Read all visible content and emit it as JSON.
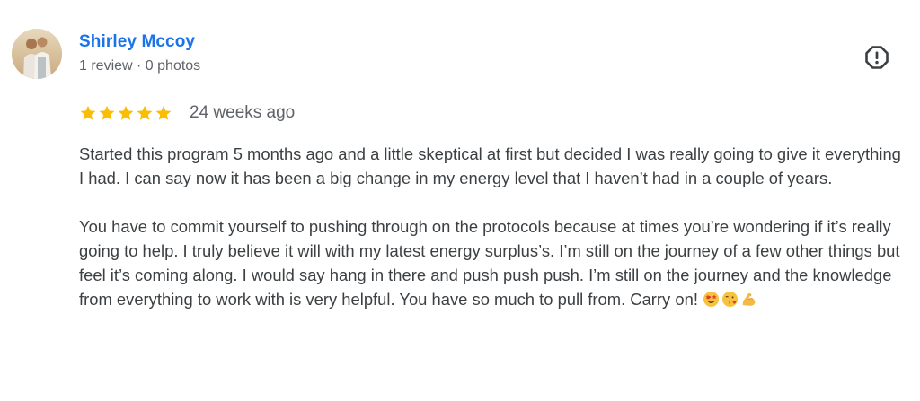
{
  "reviewer": {
    "name": "Shirley Mccoy",
    "meta": "1 review · 0 photos"
  },
  "rating": {
    "stars": 5,
    "max": 5,
    "date": "24 weeks ago",
    "star_color": "#fbbc04"
  },
  "review": {
    "paragraph_1": "Started this program 5 months ago and a little skeptical at first but decided I was really going to give it everything I had. I can say now it has been a big change in my energy level that I haven’t had in a couple of years.",
    "paragraph_2": "You have to commit yourself to pushing through on the protocols because at times you’re wondering if it’s really going to help. I truly believe it will with my latest energy surplus’s. I’m still on the journey of a few other things but feel it’s coming along. I would say hang in there and push push push. I’m still on the journey and the knowledge from everything to work with is very helpful. You have so much to pull from. Carry on!",
    "emojis": [
      "star-struck-emoji",
      "face-blowing-kiss-emoji",
      "flexed-biceps-emoji"
    ]
  },
  "colors": {
    "name_link": "#1a73e8",
    "meta_text": "#5f6368",
    "body_text": "#3c4043",
    "flag_icon": "#3c4043"
  },
  "icons": {
    "flag": "report-flag-icon"
  }
}
